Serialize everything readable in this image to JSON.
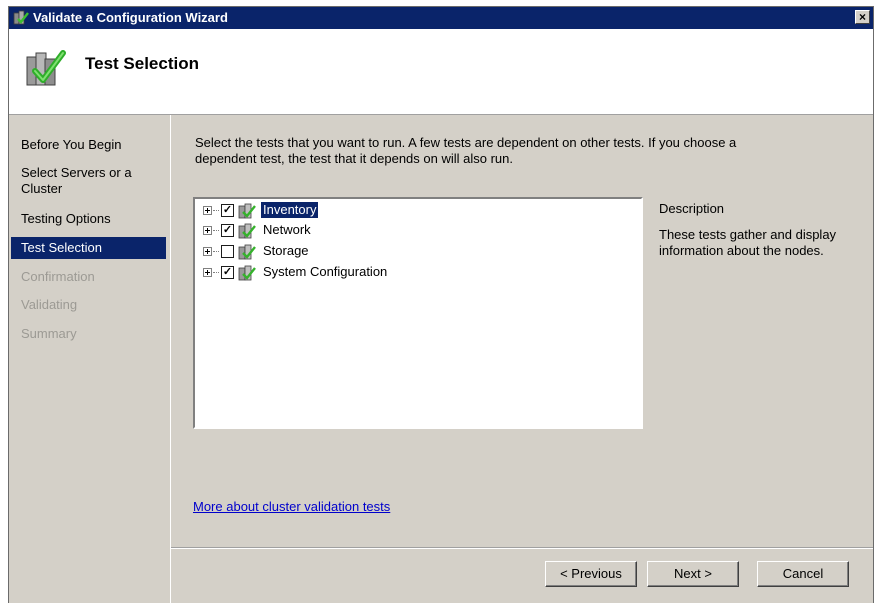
{
  "window": {
    "title": "Validate a Configuration Wizard",
    "close_label": "×",
    "page_heading": "Test Selection"
  },
  "sidebar": {
    "steps": [
      {
        "label": "Before You Begin",
        "state": "done"
      },
      {
        "label": "Select Servers or a Cluster",
        "state": "done"
      },
      {
        "label": "Testing Options",
        "state": "done"
      },
      {
        "label": "Test Selection",
        "state": "active"
      },
      {
        "label": "Confirmation",
        "state": "disabled"
      },
      {
        "label": "Validating",
        "state": "disabled"
      },
      {
        "label": "Summary",
        "state": "disabled"
      }
    ]
  },
  "content": {
    "instructions": "Select the tests that you want to run.  A few tests are dependent on other tests.  If you choose a dependent test, the test that it depends on will also run.",
    "tests": [
      {
        "label": "Inventory",
        "checked": true,
        "selected": true
      },
      {
        "label": "Network",
        "checked": true,
        "selected": false
      },
      {
        "label": "Storage",
        "checked": false,
        "selected": false
      },
      {
        "label": "System Configuration",
        "checked": true,
        "selected": false
      }
    ],
    "description_title": "Description",
    "description_text": "These tests gather and display information about the nodes.",
    "more_link": "More about cluster validation tests"
  },
  "buttons": {
    "previous": "< Previous",
    "next": "Next >",
    "cancel": "Cancel"
  },
  "colors": {
    "titlebar": "#0a246a",
    "selection": "#0a246a",
    "dialog_bg": "#d4d0c8",
    "link": "#0000cc"
  }
}
